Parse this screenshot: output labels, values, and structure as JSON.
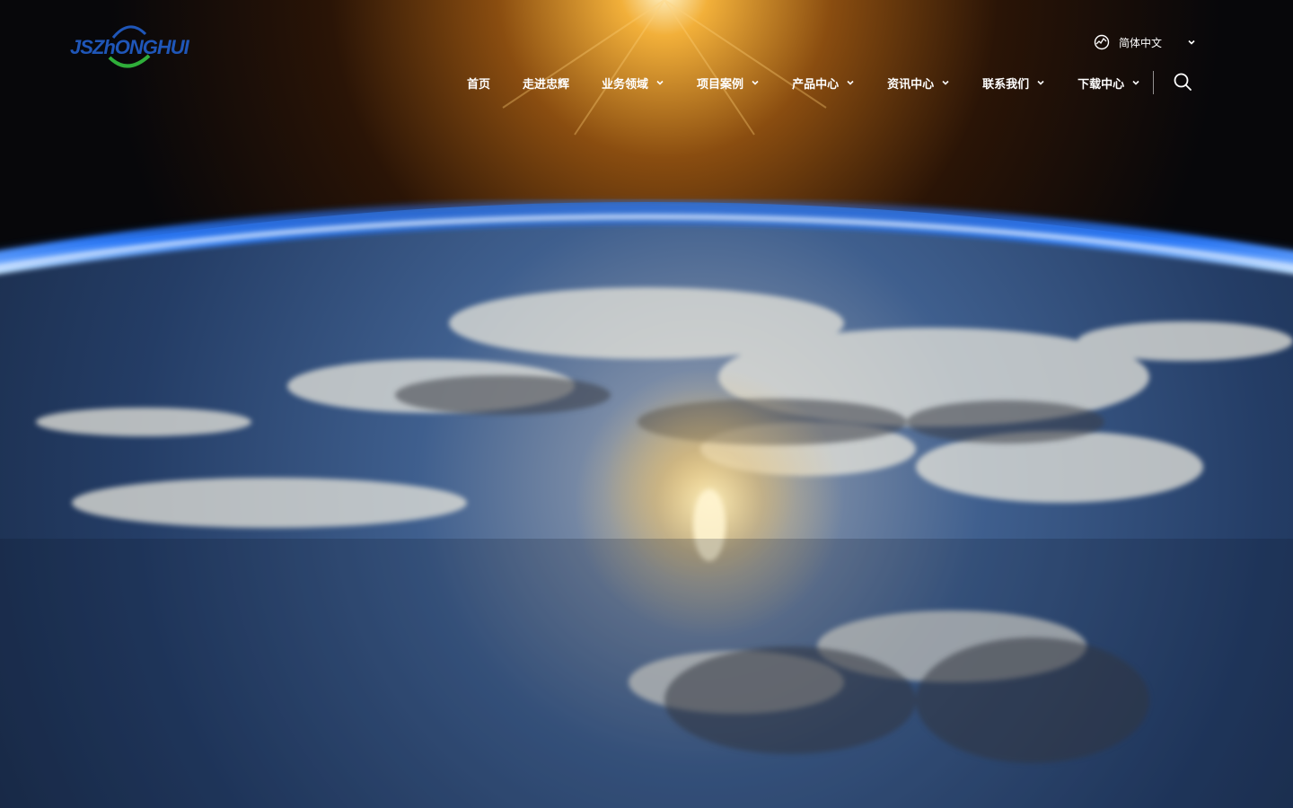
{
  "brand": {
    "logo_text": "JSZhONGHUI"
  },
  "language": {
    "current": "简体中文",
    "icon": "globe-icon"
  },
  "nav": {
    "items": [
      {
        "label": "首页",
        "has_dropdown": false
      },
      {
        "label": "走进忠辉",
        "has_dropdown": false
      },
      {
        "label": "业务领域",
        "has_dropdown": true
      },
      {
        "label": "项目案例",
        "has_dropdown": true
      },
      {
        "label": "产品中心",
        "has_dropdown": true
      },
      {
        "label": "资讯中心",
        "has_dropdown": true
      },
      {
        "label": "联系我们",
        "has_dropdown": true
      },
      {
        "label": "下载中心",
        "has_dropdown": true
      }
    ],
    "search_icon": "search-icon"
  },
  "hero": {
    "image": "earth-from-space-sunrise"
  },
  "colors": {
    "logo_blue": "#1f56b8",
    "logo_green": "#2fae3a",
    "nav_text": "#ffffff"
  }
}
